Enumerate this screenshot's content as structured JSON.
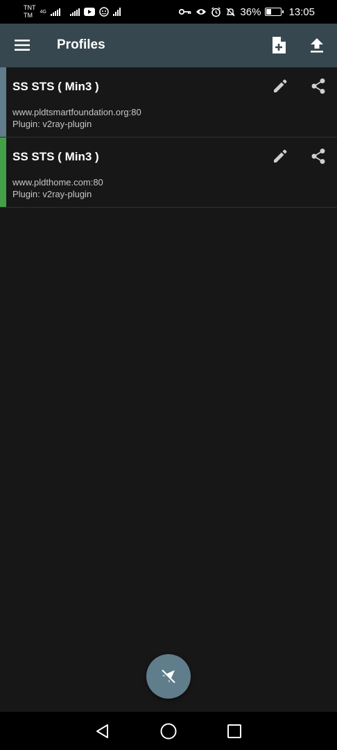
{
  "status_bar": {
    "carrier_top": "TNT",
    "carrier_bottom": "TM",
    "network_type": "4G",
    "battery_percent": "36%",
    "battery_level": 0.36,
    "time": "13:05"
  },
  "app_bar": {
    "title": "Profiles"
  },
  "profiles": [
    {
      "name": "SS STS ( Min3 )",
      "host": "www.pldtsmartfoundation.org:80",
      "plugin": "Plugin: v2ray-plugin",
      "indicator_color": "#607d8b"
    },
    {
      "name": "SS STS ( Min3 )",
      "host": "www.pldthome.com:80",
      "plugin": "Plugin: v2ray-plugin",
      "indicator_color": "#43a047"
    }
  ],
  "icons": {
    "menu": "menu-icon",
    "add_file": "add-file-icon",
    "upload": "upload-icon",
    "edit": "edit-icon",
    "share": "share-icon",
    "fab": "airplane-off-icon",
    "nav_back": "back-triangle-icon",
    "nav_home": "home-circle-icon",
    "nav_recents": "recents-square-icon"
  },
  "colors": {
    "app_bar": "#37474f",
    "background": "#171717",
    "fab": "#607d8b",
    "active_indicator": "#43a047"
  }
}
